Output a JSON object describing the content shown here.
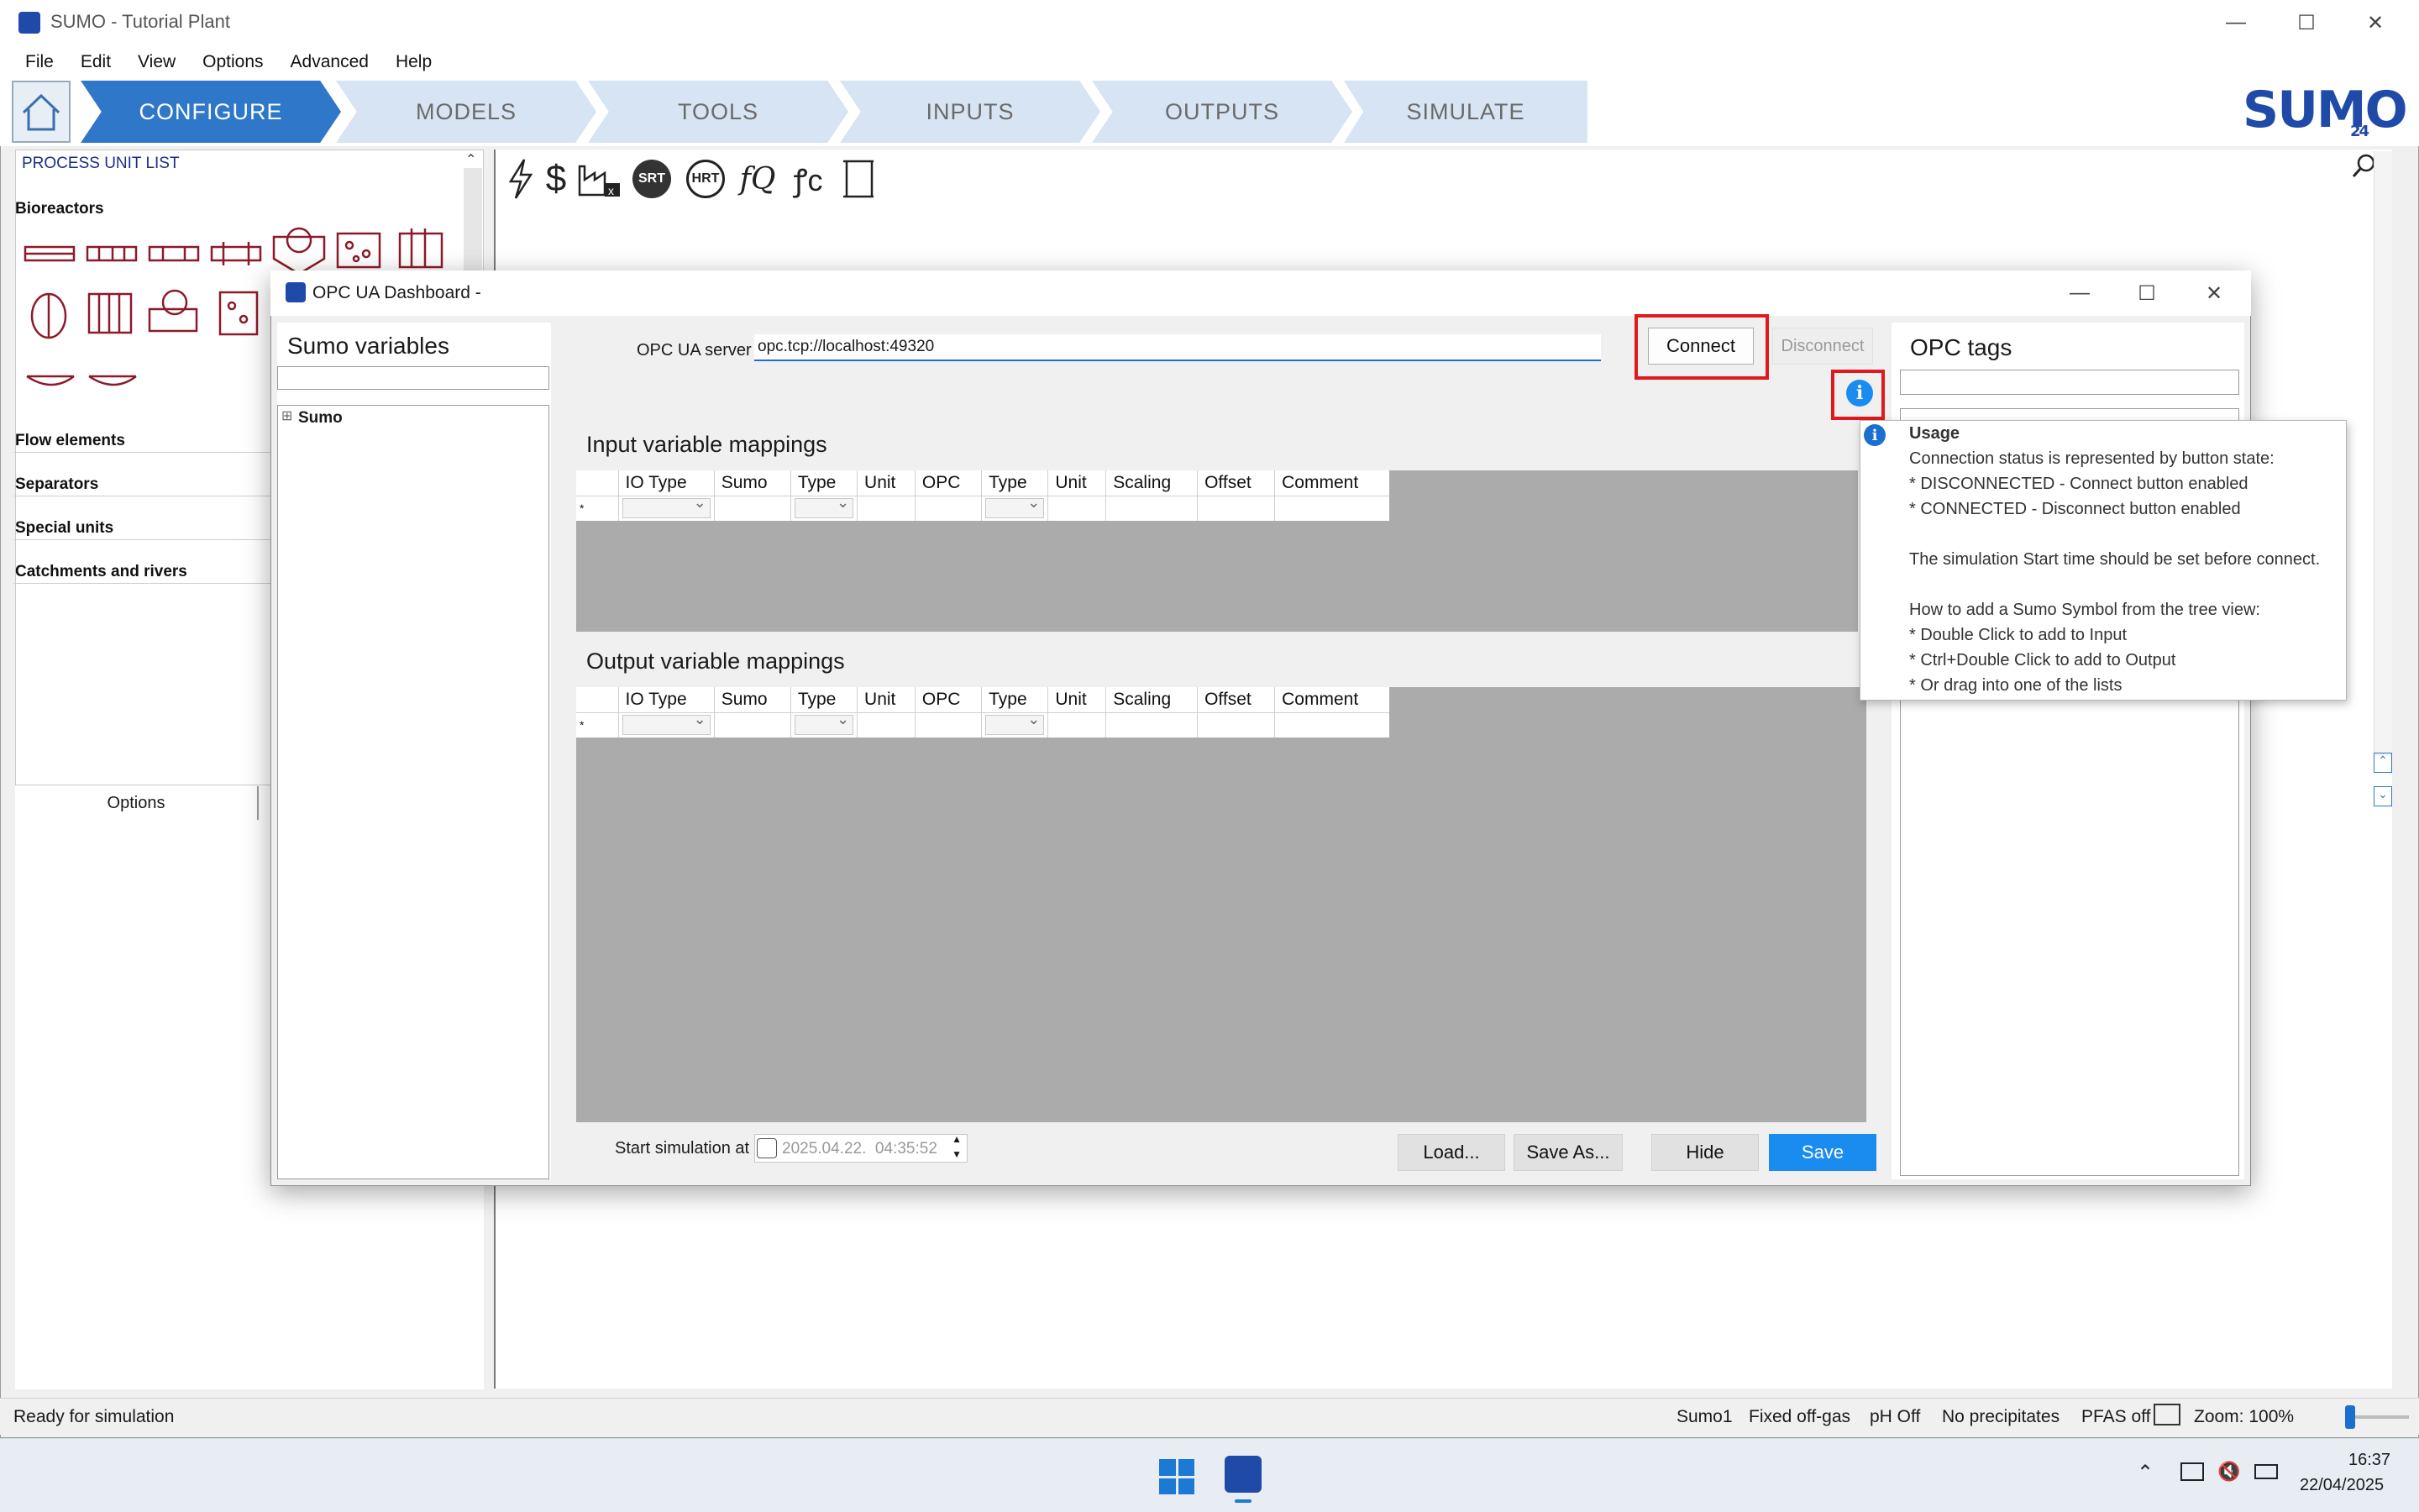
{
  "window": {
    "title": "SUMO - Tutorial Plant"
  },
  "menu": [
    "File",
    "Edit",
    "View",
    "Options",
    "Advanced",
    "Help"
  ],
  "tabs": [
    "CONFIGURE",
    "MODELS",
    "TOOLS",
    "INPUTS",
    "OUTPUTS",
    "SIMULATE"
  ],
  "active_tab": "CONFIGURE",
  "logo": {
    "text": "SUMO",
    "badge": "24"
  },
  "left_panel": {
    "title": "PROCESS UNIT LIST",
    "sections": [
      "Bioreactors",
      "Flow elements",
      "Separators",
      "Special units",
      "Catchments and rivers"
    ],
    "options_tab": "Options"
  },
  "toolbar_icons": [
    "lightning-icon",
    "dollar-icon",
    "factory-x-icon",
    "srt-icon",
    "hrt-icon",
    "fq-icon",
    "footprint-c-icon",
    "scroll-icon"
  ],
  "toolbar_labels": {
    "srt": "SRT",
    "hrt": "HRT"
  },
  "dialog": {
    "title": "OPC UA Dashboard -",
    "sumo_variables": {
      "title": "Sumo variables",
      "tree_root": "Sumo",
      "tree_expander": "⊞"
    },
    "server_label": "OPC UA server",
    "server_value": "opc.tcp://localhost:49320",
    "connect": "Connect",
    "disconnect": "Disconnect",
    "opc_tags": {
      "title": "OPC tags"
    },
    "input_title": "Input variable mappings",
    "output_title": "Output variable mappings",
    "columns": [
      "IO Type",
      "Sumo",
      "Type",
      "Unit",
      "OPC",
      "Type",
      "Unit",
      "Scaling",
      "Offset",
      "Comment"
    ],
    "new_row_marker": "*",
    "start_label": "Start simulation at",
    "start_value": "2025.04.22.  04:35:52",
    "buttons": {
      "load": "Load...",
      "save_as": "Save As...",
      "hide": "Hide",
      "save": "Save"
    }
  },
  "tooltip": {
    "title": "Usage",
    "lines": [
      "Connection status is represented by button state:",
      "* DISCONNECTED - Connect button enabled",
      "* CONNECTED - Disconnect button enabled",
      "",
      "The simulation Start time should be set before connect.",
      "",
      "How to add a Sumo Symbol from the tree view:",
      "* Double Click to add to Input",
      "* Ctrl+Double Click to add to Output",
      "* Or drag into one of the lists"
    ]
  },
  "status": {
    "left": "Ready for simulation",
    "items": [
      "Sumo1",
      "Fixed off-gas",
      "pH Off",
      "No precipitates",
      "PFAS off"
    ],
    "zoom": "Zoom: 100%"
  },
  "taskbar": {
    "time": "16:37",
    "date": "22/04/2025"
  },
  "colors": {
    "accent": "#2f77c9",
    "tab_bg": "#d6e4f3",
    "highlight": "#e0191f",
    "save_btn": "#1a8cf0"
  }
}
